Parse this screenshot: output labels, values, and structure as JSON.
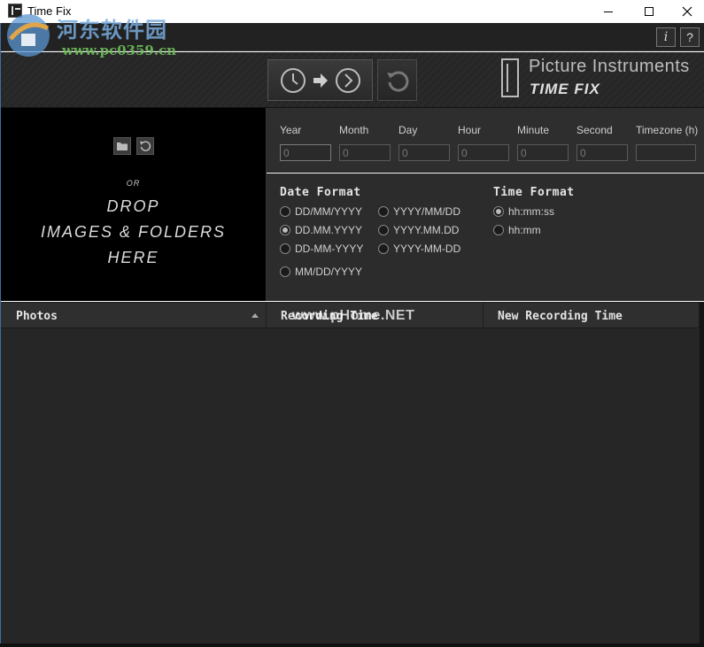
{
  "window": {
    "title": "Time Fix"
  },
  "watermark": {
    "site_cn": "河东软件园",
    "url": "www.pc0359.cn",
    "overlay": "www.pHome.NET"
  },
  "toolbar": {
    "info_label": "i",
    "help_label": "?"
  },
  "brand": {
    "company": "Picture Instruments",
    "product": "TIME FIX"
  },
  "dropzone": {
    "or_label": "OR",
    "line1": "DROP",
    "line2": "IMAGES & FOLDERS",
    "line3": "HERE"
  },
  "offset_fields": [
    {
      "label": "Year",
      "placeholder": "0"
    },
    {
      "label": "Month",
      "placeholder": "0"
    },
    {
      "label": "Day",
      "placeholder": "0"
    },
    {
      "label": "Hour",
      "placeholder": "0"
    },
    {
      "label": "Minute",
      "placeholder": "0"
    },
    {
      "label": "Second",
      "placeholder": "0"
    },
    {
      "label": "Timezone (h)",
      "placeholder": ""
    }
  ],
  "date_format": {
    "heading": "Date Format",
    "options": [
      "DD/MM/YYYY",
      "YYYY/MM/DD",
      "DD.MM.YYYY",
      "YYYY.MM.DD",
      "DD-MM-YYYY",
      "YYYY-MM-DD",
      "MM/DD/YYYY"
    ],
    "selected": "DD.MM.YYYY"
  },
  "time_format": {
    "heading": "Time Format",
    "options": [
      "hh:mm:ss",
      "hh:mm"
    ],
    "selected": "hh:mm:ss"
  },
  "table": {
    "columns": [
      "Photos",
      "Recording Time",
      "New Recording Time"
    ],
    "sort_column": "Photos",
    "sort_direction": "ascending",
    "rows": []
  },
  "colors": {
    "background_dark": "#262626",
    "panel": "#2e2e2e",
    "dropzone": "#000000",
    "text_light": "#e4e4e4"
  }
}
